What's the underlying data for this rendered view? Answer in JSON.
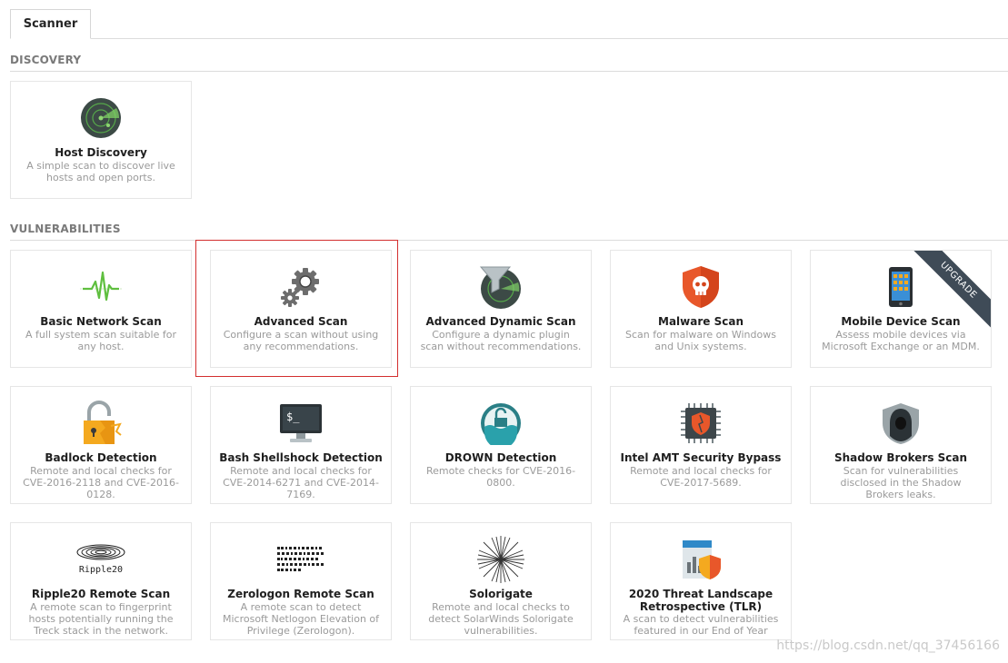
{
  "tabs": {
    "scanner": "Scanner"
  },
  "sections": {
    "discovery": "DISCOVERY",
    "vulnerabilities": "VULNERABILITIES"
  },
  "cards": {
    "host_discovery": {
      "title": "Host Discovery",
      "desc": "A simple scan to discover live hosts and open ports.",
      "icon": "radar-icon"
    },
    "basic_network": {
      "title": "Basic Network Scan",
      "desc": "A full system scan suitable for any host.",
      "icon": "pulse-icon"
    },
    "advanced": {
      "title": "Advanced Scan",
      "desc": "Configure a scan without using any recommendations.",
      "icon": "gears-icon"
    },
    "advanced_dynamic": {
      "title": "Advanced Dynamic Scan",
      "desc": "Configure a dynamic plugin scan without recommendations.",
      "icon": "filter-radar-icon"
    },
    "malware": {
      "title": "Malware Scan",
      "desc": "Scan for malware on Windows and Unix systems.",
      "icon": "skull-shield-icon"
    },
    "mobile_device": {
      "title": "Mobile Device Scan",
      "desc": "Assess mobile devices via Microsoft Exchange or an MDM.",
      "icon": "phone-icon",
      "badge": "UPGRADE"
    },
    "badlock": {
      "title": "Badlock Detection",
      "desc": "Remote and local checks for CVE-2016-2118 and CVE-2016-0128.",
      "icon": "broken-lock-icon"
    },
    "bash_shellshock": {
      "title": "Bash Shellshock Detection",
      "desc": "Remote and local checks for CVE-2014-6271 and CVE-2014-7169.",
      "icon": "terminal-icon",
      "terminal_text": "$_"
    },
    "drown": {
      "title": "DROWN Detection",
      "desc": "Remote checks for CVE-2016-0800.",
      "icon": "drowning-lock-icon"
    },
    "intel_amt": {
      "title": "Intel AMT Security Bypass",
      "desc": "Remote and local checks for CVE-2017-5689.",
      "icon": "chip-shield-icon"
    },
    "shadow_brokers": {
      "title": "Shadow Brokers Scan",
      "desc": "Scan for vulnerabilities disclosed in the Shadow Brokers leaks.",
      "icon": "hooded-figure-icon"
    },
    "ripple20": {
      "title": "Ripple20 Remote Scan",
      "desc": "A remote scan to fingerprint hosts potentially running the Treck stack in the network.",
      "icon": "ripple-icon",
      "logo_text": "Ripple20"
    },
    "zerologon": {
      "title": "Zerologon Remote Scan",
      "desc": "A remote scan to detect Microsoft Netlogon Elevation of Privilege (Zerologon).",
      "icon": "hex-dump-icon"
    },
    "solorigate": {
      "title": "Solorigate",
      "desc": "Remote and local checks to detect SolarWinds Solorigate vulnerabilities.",
      "icon": "starburst-icon"
    },
    "tlr": {
      "title": "2020 Threat Landscape Retrospective (TLR)",
      "desc": "A scan to detect vulnerabilities featured in our End of Year",
      "icon": "report-shield-icon"
    }
  },
  "watermark": "https://blog.csdn.net/qq_37456166",
  "colors": {
    "selection": "#d32f2f",
    "accent_orange": "#f4a91f",
    "accent_red": "#e8572a",
    "pulse_green": "#5fbf3f"
  }
}
